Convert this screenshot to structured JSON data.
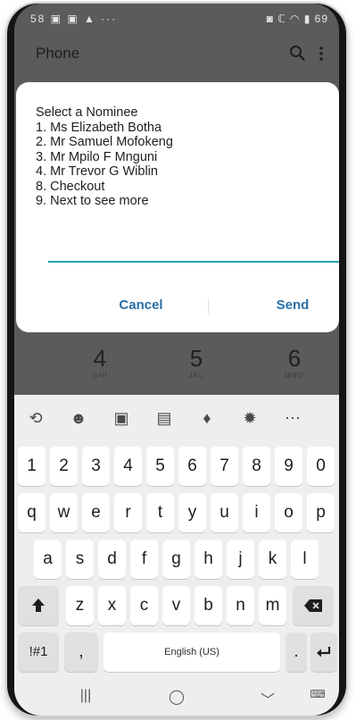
{
  "status_bar": {
    "left_text": "58 ▣ ▣ ▲ ···",
    "right_text": "◙ ℂ ◠ ▮ 69"
  },
  "app_bar": {
    "title": "Phone",
    "icons": [
      "search-icon",
      "more-vert-icon"
    ]
  },
  "dialog": {
    "lines": [
      "Select a Nominee",
      "1. Ms Elizabeth Botha",
      "2. Mr Samuel Mofokeng",
      "3. Mr Mpilo F Mnguni",
      "4. Mr Trevor G Wiblin",
      "8. Checkout",
      "9. Next to see more"
    ],
    "input_value": "",
    "cancel_label": "Cancel",
    "send_label": "Send",
    "accent_color": "#28a1b3",
    "button_color": "#2a6fa6"
  },
  "dialpad": {
    "keys": [
      {
        "digit": "4",
        "letters": "GHI"
      },
      {
        "digit": "5",
        "letters": "JKL"
      },
      {
        "digit": "6",
        "letters": "MNO"
      }
    ]
  },
  "keyboard": {
    "toolbar": [
      "translate-icon",
      "emoji-icon",
      "sticker-icon",
      "clipboard-icon",
      "mic-icon",
      "settings-icon",
      "more-icon"
    ],
    "number_row": [
      "1",
      "2",
      "3",
      "4",
      "5",
      "6",
      "7",
      "8",
      "9",
      "0"
    ],
    "row1": [
      "q",
      "w",
      "e",
      "r",
      "t",
      "y",
      "u",
      "i",
      "o",
      "p"
    ],
    "row2": [
      "a",
      "s",
      "d",
      "f",
      "g",
      "h",
      "j",
      "k",
      "l"
    ],
    "row3": [
      "z",
      "x",
      "c",
      "v",
      "b",
      "n",
      "m"
    ],
    "symbols_label": "!#1",
    "comma_label": ",",
    "space_label": "English (US)",
    "period_label": ".",
    "shift_icon": "shift-icon",
    "backspace_icon": "backspace-icon",
    "enter_icon": "enter-icon"
  },
  "nav_bar": {
    "recents": "|||",
    "home": "◯",
    "back": "﹀",
    "keyboard_switch": "⌨"
  }
}
